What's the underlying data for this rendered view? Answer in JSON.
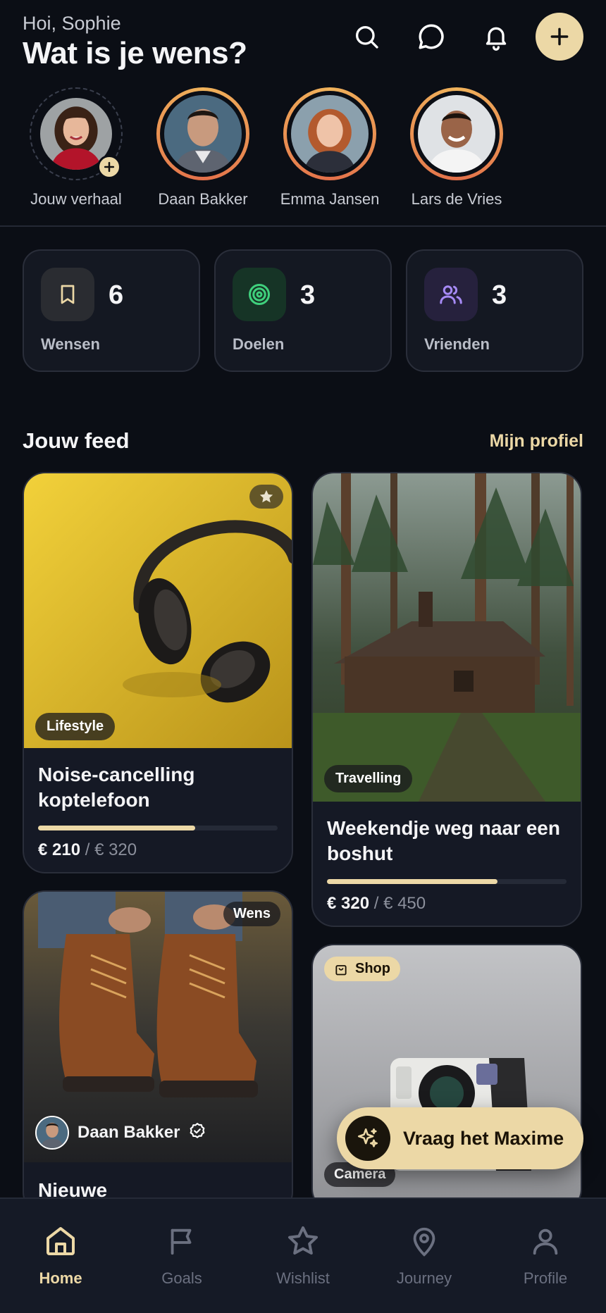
{
  "header": {
    "greeting": "Hoi, Sophie",
    "title": "Wat is je wens?"
  },
  "stories": [
    {
      "name": "Jouw verhaal",
      "own": true
    },
    {
      "name": "Daan Bakker"
    },
    {
      "name": "Emma Jansen"
    },
    {
      "name": "Lars de Vries"
    }
  ],
  "stats": [
    {
      "value": "6",
      "label": "Wensen",
      "icon": "bookmark-icon"
    },
    {
      "value": "3",
      "label": "Doelen",
      "icon": "target-icon"
    },
    {
      "value": "3",
      "label": "Vrienden",
      "icon": "users-icon"
    }
  ],
  "feed": {
    "title": "Jouw feed",
    "profile_link": "Mijn profiel",
    "cards": [
      {
        "tag": "Lifestyle",
        "title": "Noise-cancelling koptelefoon",
        "current": "€ 210",
        "goal": "/ € 320",
        "progress": 0.656
      },
      {
        "tag": "Travelling",
        "title": "Weekendje weg naar een boshut",
        "current": "€ 320",
        "goal": "/ € 450",
        "progress": 0.711
      },
      {
        "badge": "Wens",
        "user": "Daan Bakker",
        "title": "Nieuwe"
      },
      {
        "badge": "Shop",
        "tag": "Camera"
      }
    ]
  },
  "fab": {
    "label": "Vraag het Maxime"
  },
  "nav": [
    {
      "label": "Home",
      "active": true
    },
    {
      "label": "Goals"
    },
    {
      "label": "Wishlist"
    },
    {
      "label": "Journey"
    },
    {
      "label": "Profile"
    }
  ],
  "colors": {
    "accent": "#ecd8a6",
    "background": "#0b0e15",
    "card": "#151925"
  }
}
